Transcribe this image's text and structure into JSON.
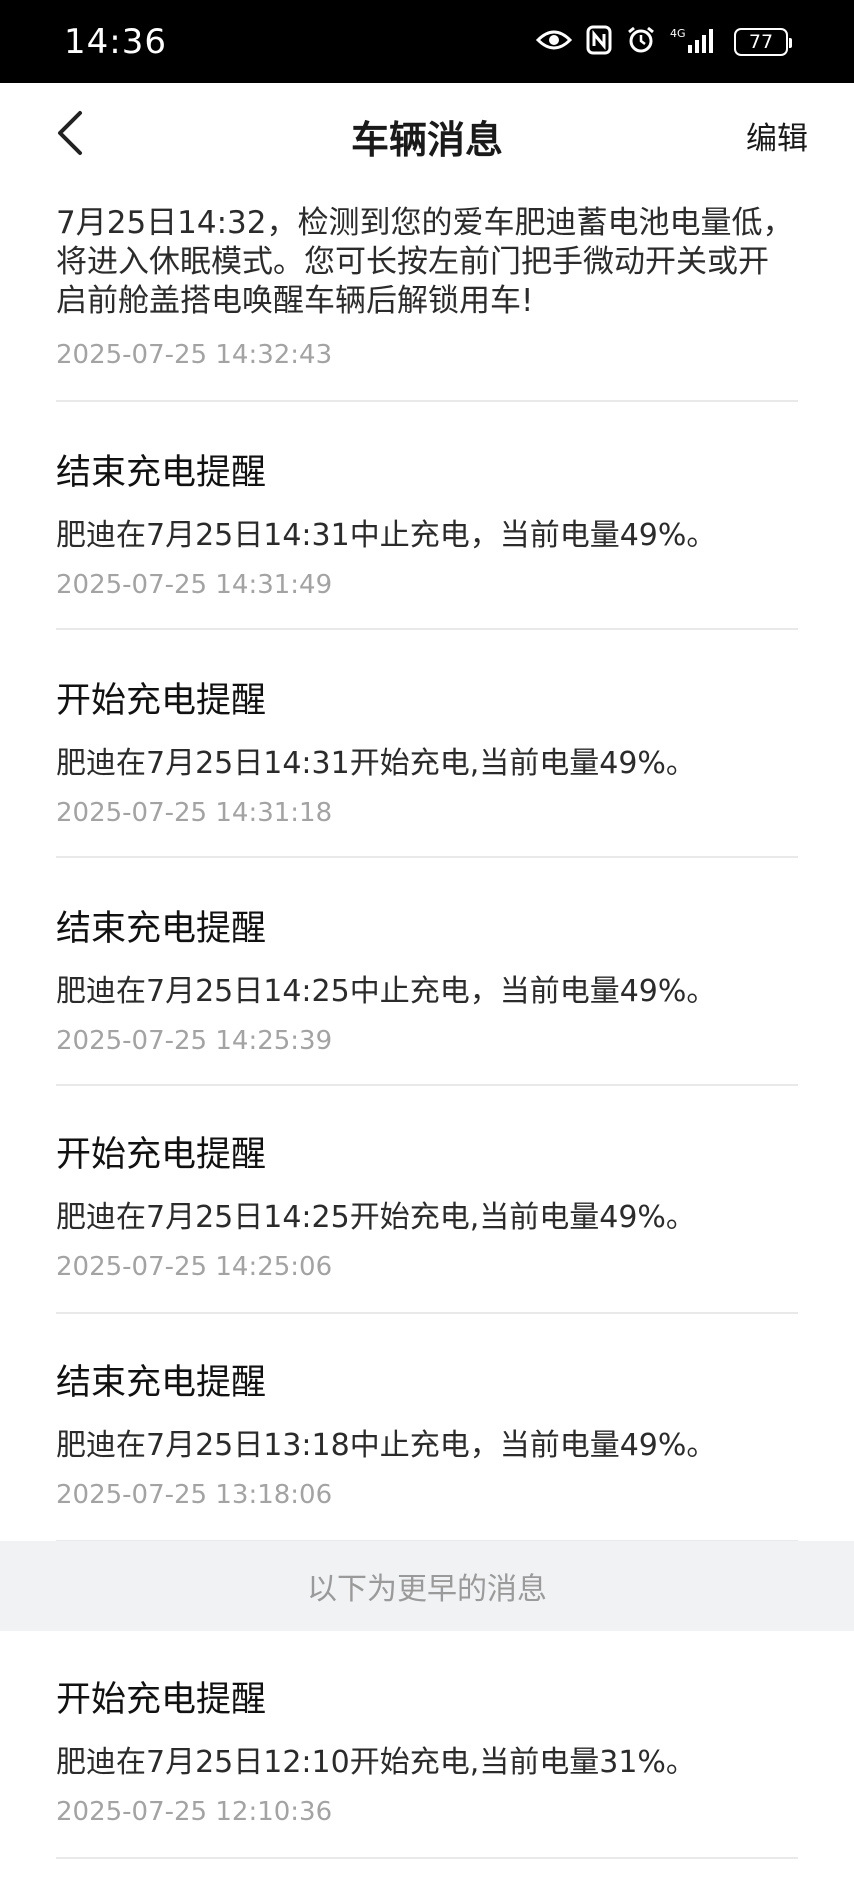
{
  "status_bar": {
    "time": "14:36",
    "battery": "77",
    "network": "4G",
    "icons": [
      "eye-icon",
      "nfc-icon",
      "alarm-icon",
      "signal-icon",
      "battery-icon"
    ]
  },
  "header": {
    "title": "车辆消息",
    "edit_label": "编辑"
  },
  "messages": [
    {
      "body": "7月25日14:32，检测到您的爱车肥迪蓄电池电量低，将进入休眠模式。您可长按左前门把手微动开关或开启前舱盖搭电唤醒车辆后解锁用车!",
      "time": "2025-07-25 14:32:43"
    },
    {
      "title": "结束充电提醒",
      "body": "肥迪在7月25日14:31中止充电，当前电量49%。",
      "time": "2025-07-25 14:31:49"
    },
    {
      "title": "开始充电提醒",
      "body": "肥迪在7月25日14:31开始充电,当前电量49%。",
      "time": "2025-07-25 14:31:18"
    },
    {
      "title": "结束充电提醒",
      "body": "肥迪在7月25日14:25中止充电，当前电量49%。",
      "time": "2025-07-25 14:25:39"
    },
    {
      "title": "开始充电提醒",
      "body": "肥迪在7月25日14:25开始充电,当前电量49%。",
      "time": "2025-07-25 14:25:06"
    },
    {
      "title": "结束充电提醒",
      "body": "肥迪在7月25日13:18中止充电，当前电量49%。",
      "time": "2025-07-25 13:18:06"
    }
  ],
  "earlier_banner": "以下为更早的消息",
  "earlier_messages": [
    {
      "title": "开始充电提醒",
      "body": "肥迪在7月25日12:10开始充电,当前电量31%。",
      "time": "2025-07-25 12:10:36"
    }
  ],
  "colors": {
    "title_text": "#111111",
    "body_text": "#2b2b2b",
    "timestamp_text": "#a3a3a3",
    "banner_bg": "#f1f2f4",
    "divider": "#e9e9e9"
  }
}
